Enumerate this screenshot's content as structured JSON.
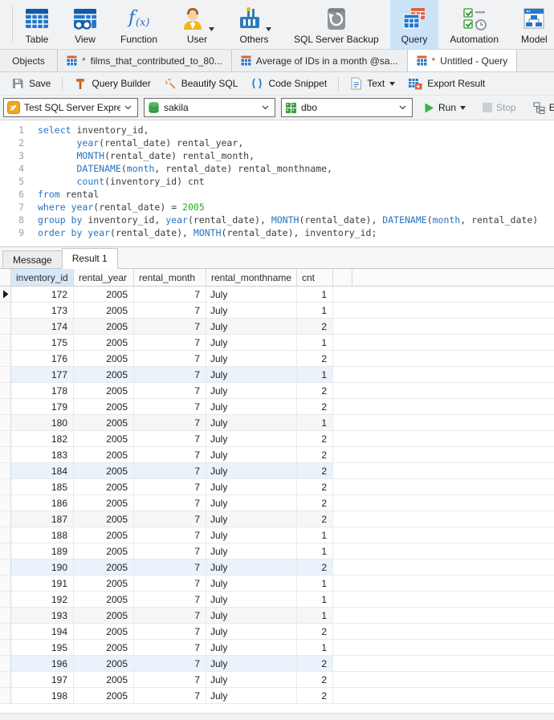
{
  "main_toolbar": {
    "items": [
      {
        "label": "Table",
        "icon": "table-icon"
      },
      {
        "label": "View",
        "icon": "view-icon"
      },
      {
        "label": "Function",
        "icon": "function-icon"
      },
      {
        "label": "User",
        "icon": "user-icon",
        "caret": true
      },
      {
        "label": "Others",
        "icon": "others-icon",
        "caret": true
      },
      {
        "label": "SQL Server Backup",
        "icon": "sql-server-backup-icon"
      },
      {
        "label": "Query",
        "icon": "query-icon",
        "selected": true
      },
      {
        "label": "Automation",
        "icon": "automation-icon"
      },
      {
        "label": "Model",
        "icon": "model-icon"
      }
    ]
  },
  "tab_bar": {
    "tabs": [
      {
        "label": "Objects",
        "objects": true
      },
      {
        "label": "films_that_contributed_to_80...",
        "dirty": "*",
        "icon": "query-tab-icon"
      },
      {
        "label": "Average of IDs in a month @sa...",
        "icon": "query-tab-icon"
      },
      {
        "label": "Untitled - Query",
        "dirty": "*",
        "icon": "query-tab-icon",
        "active": true
      }
    ]
  },
  "query_toolbar": {
    "items": [
      {
        "label": "Save",
        "icon": "save-icon",
        "group": 0
      },
      {
        "label": "Query Builder",
        "icon": "query-builder-icon",
        "group": 1
      },
      {
        "label": "Beautify SQL",
        "icon": "beautify-sql-icon",
        "group": 1
      },
      {
        "label": "Code Snippet",
        "icon": "code-snippet-icon",
        "group": 1
      },
      {
        "label": "Text",
        "icon": "text-file-icon",
        "caret": true,
        "group": 2
      },
      {
        "label": "Export Result",
        "icon": "export-result-icon",
        "group": 2
      }
    ]
  },
  "connection_bar": {
    "server": {
      "value": "Test SQL Server Expres",
      "icon": "connection-icon"
    },
    "database": {
      "value": "sakila",
      "icon": "database-icon"
    },
    "schema": {
      "value": "dbo",
      "icon": "schema-icon"
    },
    "run_label": "Run",
    "stop_label": "Stop",
    "explain_label": "Explain"
  },
  "editor": {
    "lines": [
      {
        "n": "1",
        "tokens": [
          [
            "k",
            "select"
          ],
          [
            "p",
            " inventory_id,"
          ]
        ]
      },
      {
        "n": "2",
        "tokens": [
          [
            "p",
            "       "
          ],
          [
            "k",
            "year"
          ],
          [
            "p",
            "(rental_date) rental_year,"
          ]
        ]
      },
      {
        "n": "3",
        "tokens": [
          [
            "p",
            "       "
          ],
          [
            "k",
            "MONTH"
          ],
          [
            "p",
            "(rental_date) rental_month,"
          ]
        ]
      },
      {
        "n": "4",
        "tokens": [
          [
            "p",
            "       "
          ],
          [
            "k",
            "DATENAME"
          ],
          [
            "p",
            "("
          ],
          [
            "k",
            "month"
          ],
          [
            "p",
            ", rental_date) rental_monthname,"
          ]
        ]
      },
      {
        "n": "5",
        "tokens": [
          [
            "p",
            "       "
          ],
          [
            "k",
            "count"
          ],
          [
            "p",
            "(inventory_id) cnt"
          ]
        ]
      },
      {
        "n": "6",
        "tokens": [
          [
            "k",
            "from"
          ],
          [
            "p",
            " rental"
          ]
        ]
      },
      {
        "n": "7",
        "tokens": [
          [
            "k",
            "where"
          ],
          [
            "p",
            " "
          ],
          [
            "k",
            "year"
          ],
          [
            "p",
            "(rental_date) = "
          ],
          [
            "n",
            "2005"
          ]
        ]
      },
      {
        "n": "8",
        "tokens": [
          [
            "k",
            "group by"
          ],
          [
            "p",
            " inventory_id, "
          ],
          [
            "k",
            "year"
          ],
          [
            "p",
            "(rental_date), "
          ],
          [
            "k",
            "MONTH"
          ],
          [
            "p",
            "(rental_date), "
          ],
          [
            "k",
            "DATENAME"
          ],
          [
            "p",
            "("
          ],
          [
            "k",
            "month"
          ],
          [
            "p",
            ", rental_date)"
          ]
        ]
      },
      {
        "n": "9",
        "tokens": [
          [
            "k",
            "order by"
          ],
          [
            "p",
            " "
          ],
          [
            "k",
            "year"
          ],
          [
            "p",
            "(rental_date), "
          ],
          [
            "k",
            "MONTH"
          ],
          [
            "p",
            "(rental_date), inventory_id;"
          ]
        ]
      }
    ]
  },
  "result_panel": {
    "tabs": [
      {
        "label": "Message"
      },
      {
        "label": "Result 1",
        "active": true
      }
    ]
  },
  "grid": {
    "columns": [
      "inventory_id",
      "rental_year",
      "rental_month",
      "rental_monthname",
      "cnt"
    ],
    "selected_column": "inventory_id",
    "rows": [
      [
        172,
        2005,
        7,
        "July",
        1
      ],
      [
        173,
        2005,
        7,
        "July",
        1
      ],
      [
        174,
        2005,
        7,
        "July",
        2
      ],
      [
        175,
        2005,
        7,
        "July",
        1
      ],
      [
        176,
        2005,
        7,
        "July",
        2
      ],
      [
        177,
        2005,
        7,
        "July",
        1
      ],
      [
        178,
        2005,
        7,
        "July",
        2
      ],
      [
        179,
        2005,
        7,
        "July",
        2
      ],
      [
        180,
        2005,
        7,
        "July",
        1
      ],
      [
        182,
        2005,
        7,
        "July",
        2
      ],
      [
        183,
        2005,
        7,
        "July",
        2
      ],
      [
        184,
        2005,
        7,
        "July",
        2
      ],
      [
        185,
        2005,
        7,
        "July",
        2
      ],
      [
        186,
        2005,
        7,
        "July",
        2
      ],
      [
        187,
        2005,
        7,
        "July",
        2
      ],
      [
        188,
        2005,
        7,
        "July",
        1
      ],
      [
        189,
        2005,
        7,
        "July",
        1
      ],
      [
        190,
        2005,
        7,
        "July",
        2
      ],
      [
        191,
        2005,
        7,
        "July",
        1
      ],
      [
        192,
        2005,
        7,
        "July",
        1
      ],
      [
        193,
        2005,
        7,
        "July",
        1
      ],
      [
        194,
        2005,
        7,
        "July",
        2
      ],
      [
        195,
        2005,
        7,
        "July",
        1
      ],
      [
        196,
        2005,
        7,
        "July",
        2
      ],
      [
        197,
        2005,
        7,
        "July",
        2
      ],
      [
        198,
        2005,
        7,
        "July",
        2
      ]
    ]
  },
  "colors": {
    "toolbar_selected_bg": "#cbe3f7",
    "keyword_blue": "#2474c2",
    "number_green": "#2aa52a",
    "header_selected_col": "#d7e9f9",
    "row_tint_gray": "#f5f6f7",
    "row_tint_blue": "#eaf3fb"
  }
}
